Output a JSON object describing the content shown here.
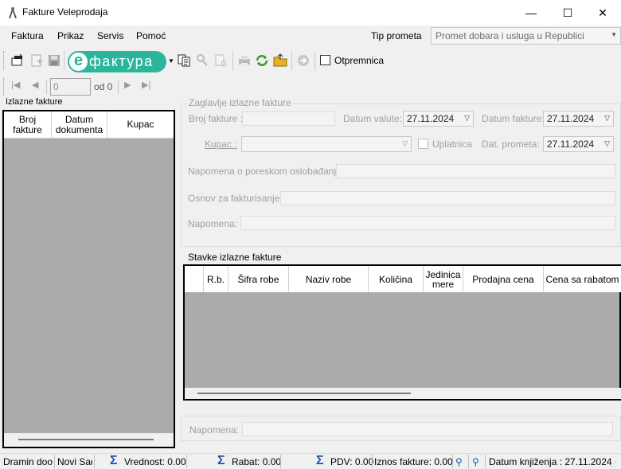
{
  "window": {
    "title": "Fakture Veleprodaja",
    "minimize": "—",
    "maximize": "☐",
    "close": "✕"
  },
  "menu": {
    "items": [
      "Faktura",
      "Prikaz",
      "Servis",
      "Pomoć"
    ],
    "tip_label": "Tip prometa",
    "tip_value": "Promet dobara i usluga u Republici"
  },
  "toolbar": {
    "efaktura_logo": "e",
    "efaktura_text": "фактура",
    "otpremnica_label": "Otpremnica"
  },
  "nav": {
    "page_value": "0",
    "of_label": "od 0"
  },
  "left": {
    "title": "Izlazne fakture",
    "columns": [
      "Broj fakture",
      "Datum dokumenta",
      "Kupac"
    ]
  },
  "header": {
    "group_title": "Zaglavlje izlazne fakture",
    "broj_label": "Broj fakture :",
    "datum_valute_label": "Datum valute:",
    "datum_valute": "27.11.2024",
    "datum_fakture_label": "Datum fakture:",
    "datum_fakture": "27.11.2024",
    "kupac_label": "Kupac :",
    "uplatnica_label": "Uplatnica",
    "dat_prometa_label": "Dat. prometa:",
    "dat_prometa": "27.11.2024",
    "napomena_pdv_label": "Napomena o poreskom oslobađanju:",
    "osnov_label": "Osnov za fakturisanje:",
    "napomena_label": "Napomena:"
  },
  "items": {
    "title": "Stavke izlazne fakture",
    "columns": [
      "R.b.",
      "Šifra robe",
      "Naziv robe",
      "Količina",
      "Jedinica mere",
      "Prodajna cena",
      "Cena sa rabatom"
    ]
  },
  "footer": {
    "napomena_label": "Napomena:"
  },
  "status": {
    "company": "Dramin doo",
    "city": "Novi Sad",
    "vrednost": "Vrednost: 0.00",
    "rabat": "Rabat: 0.00",
    "pdv": "PDV: 0.00",
    "iznos": "Iznos fakture: 0.00",
    "datum_knjizenja": "Datum knjiženja : 27.11.2024"
  }
}
